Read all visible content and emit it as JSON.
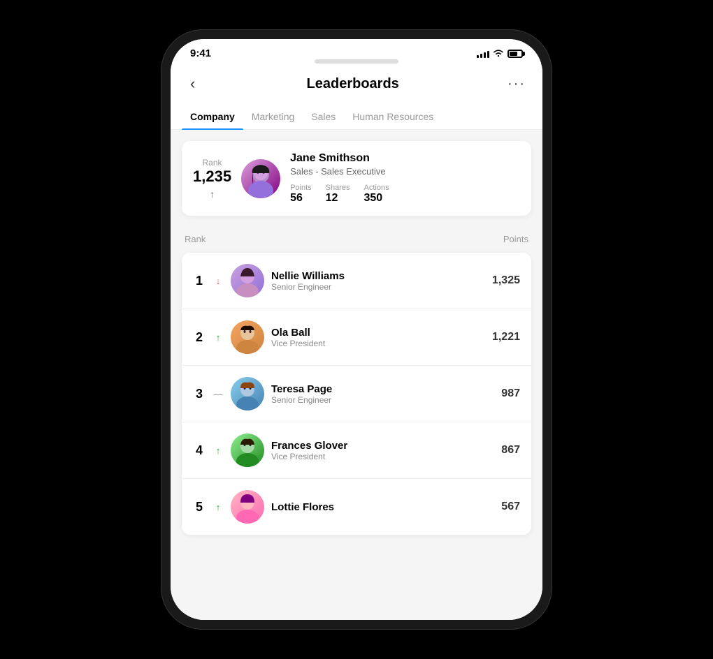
{
  "statusBar": {
    "time": "9:41",
    "signalBars": [
      4,
      6,
      8,
      10,
      12
    ],
    "battery": 70
  },
  "header": {
    "backLabel": "‹",
    "title": "Leaderboards",
    "moreLabel": "···"
  },
  "tabs": [
    {
      "id": "company",
      "label": "Company",
      "active": true
    },
    {
      "id": "marketing",
      "label": "Marketing",
      "active": false
    },
    {
      "id": "sales",
      "label": "Sales",
      "active": false
    },
    {
      "id": "hr",
      "label": "Human Resources",
      "active": false
    }
  ],
  "userCard": {
    "rankLabel": "Rank",
    "rankValue": "1,235",
    "trendIcon": "↑",
    "name": "Jane Smithson",
    "role": "Sales - Sales Executive",
    "stats": [
      {
        "label": "Points",
        "value": "56"
      },
      {
        "label": "Shares",
        "value": "12"
      },
      {
        "label": "Actions",
        "value": "350"
      }
    ]
  },
  "tableHeaders": {
    "rank": "Rank",
    "points": "Points"
  },
  "leaderboard": [
    {
      "rank": "1",
      "trend": "↓",
      "trendClass": "trend-down",
      "name": "Nellie Williams",
      "title": "Senior Engineer",
      "points": "1,325",
      "avatarClass": "av1"
    },
    {
      "rank": "2",
      "trend": "↑",
      "trendClass": "trend-up",
      "name": "Ola Ball",
      "title": "Vice President",
      "points": "1,221",
      "avatarClass": "av2"
    },
    {
      "rank": "3",
      "trend": "—",
      "trendClass": "trend-neutral",
      "name": "Teresa Page",
      "title": "Senior Engineer",
      "points": "987",
      "avatarClass": "av3"
    },
    {
      "rank": "4",
      "trend": "↑",
      "trendClass": "trend-up",
      "name": "Frances Glover",
      "title": "Vice President",
      "points": "867",
      "avatarClass": "av4"
    },
    {
      "rank": "5",
      "trend": "↑",
      "trendClass": "trend-up",
      "name": "Lottie Flores",
      "title": "",
      "points": "567",
      "avatarClass": "av5"
    }
  ]
}
